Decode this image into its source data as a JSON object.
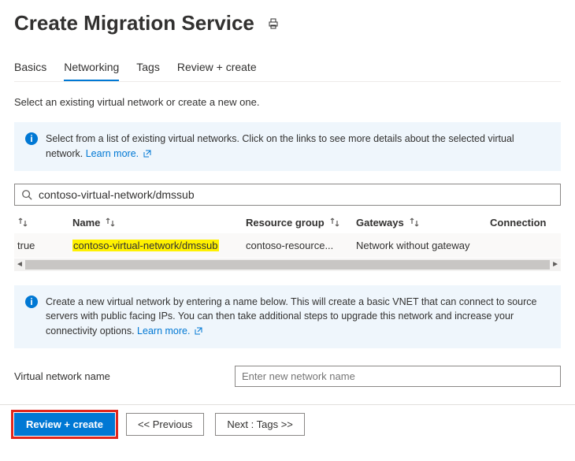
{
  "header": {
    "title": "Create Migration Service"
  },
  "tabs": [
    {
      "label": "Basics",
      "active": false
    },
    {
      "label": "Networking",
      "active": true
    },
    {
      "label": "Tags",
      "active": false
    },
    {
      "label": "Review + create",
      "active": false
    }
  ],
  "networking": {
    "instruction": "Select an existing virtual network or create a new one.",
    "info_existing": {
      "text": "Select from a list of existing virtual networks. Click on the links to see more details about the selected virtual network.",
      "learn_label": "Learn more."
    },
    "search": {
      "value": "contoso-virtual-network/dmssub"
    },
    "columns": {
      "col0": "",
      "col1": "Name",
      "col2": "Resource group",
      "col3": "Gateways",
      "col4": "Connection"
    },
    "row": {
      "selected": "true",
      "name": "contoso-virtual-network/dmssub",
      "resource_group": "contoso-resource...",
      "gateways": "Network without gateway",
      "connections": ""
    },
    "info_create": {
      "text": "Create a new virtual network by entering a name below. This will create a basic VNET that can connect to source servers with public facing IPs. You can then take additional steps to upgrade this network and increase your connectivity options.",
      "learn_label": "Learn more."
    },
    "vnet_label": "Virtual network name",
    "vnet_placeholder": "Enter new network name"
  },
  "footer": {
    "review": "Review + create",
    "previous": "<< Previous",
    "next": "Next : Tags >>"
  }
}
